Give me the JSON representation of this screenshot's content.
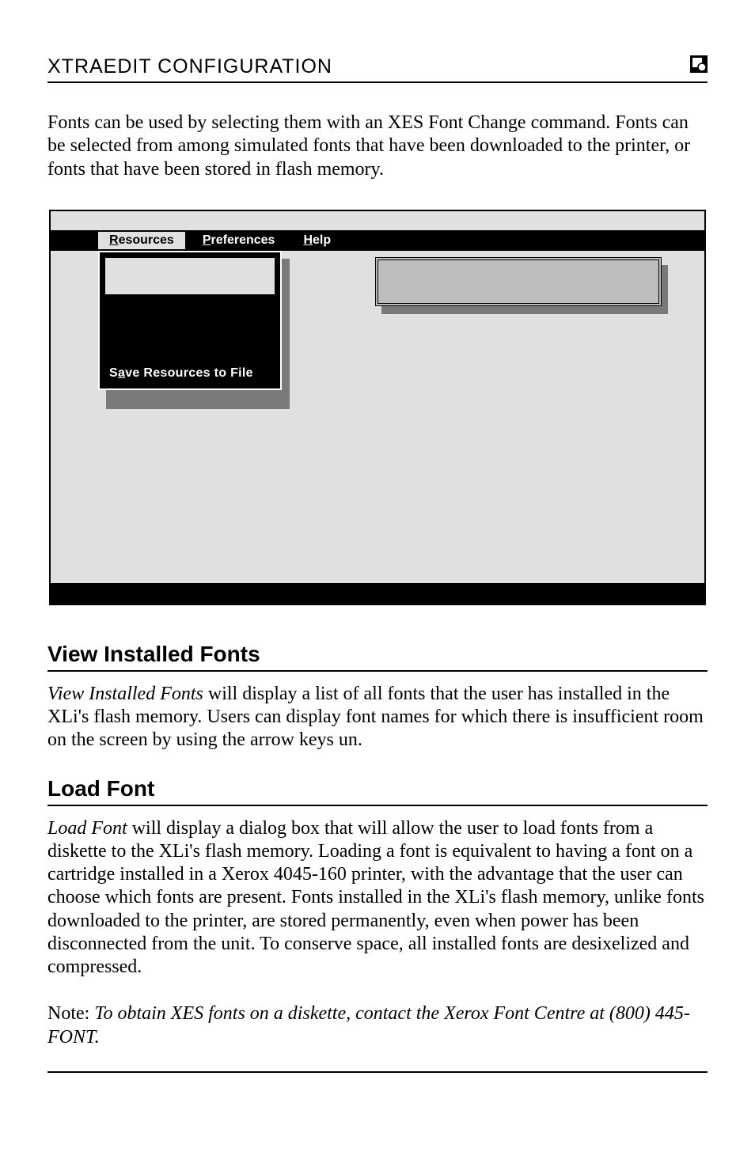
{
  "header": {
    "title": "XTRAEDIT CONFIGURATION"
  },
  "intro": "Fonts can be used by selecting them with an XES Font Change command. Fonts can be selected from among simulated fonts that have been downloaded to the printer, or fonts that have been stored in flash memory.",
  "figure": {
    "menubar": {
      "resources": {
        "u": "R",
        "rest": "esources"
      },
      "preferences": {
        "u": "P",
        "rest": "references"
      },
      "help": {
        "u": "H",
        "rest": "elp"
      }
    },
    "dropdown": {
      "save_resources": {
        "pre": "S",
        "u": "a",
        "mid": "ve ",
        "pre2": "R",
        "rest": "esources to ",
        "pre3": "F",
        "rest2": "ile"
      }
    }
  },
  "sections": {
    "view_installed": {
      "title": "View Installed Fonts",
      "lead_italic": "View Installed Fonts",
      "body_rest": " will display a list of all fonts that the user has installed in the XLi's flash memory. Users can display font names for which there is insufficient room on the screen by using the arrow keys un."
    },
    "load_font": {
      "title": "Load Font",
      "lead_italic": "Load Font",
      "body_rest": " will display a dialog box that will allow the user to load fonts from a diskette to the XLi's flash memory. Loading a font is equivalent to having a font on a cartridge installed in a Xerox 4045-160 printer, with the advantage that the user can choose which fonts are present. Fonts installed in the XLi's flash memory, unlike fonts downloaded to the printer, are stored permanently, even when power has been disconnected from the unit. To conserve space, all installed fonts are desixelized and compressed.",
      "note_label": "Note: ",
      "note_italic": "To obtain XES fonts on a diskette, contact the Xerox Font Centre at (800) 445-FONT."
    }
  }
}
